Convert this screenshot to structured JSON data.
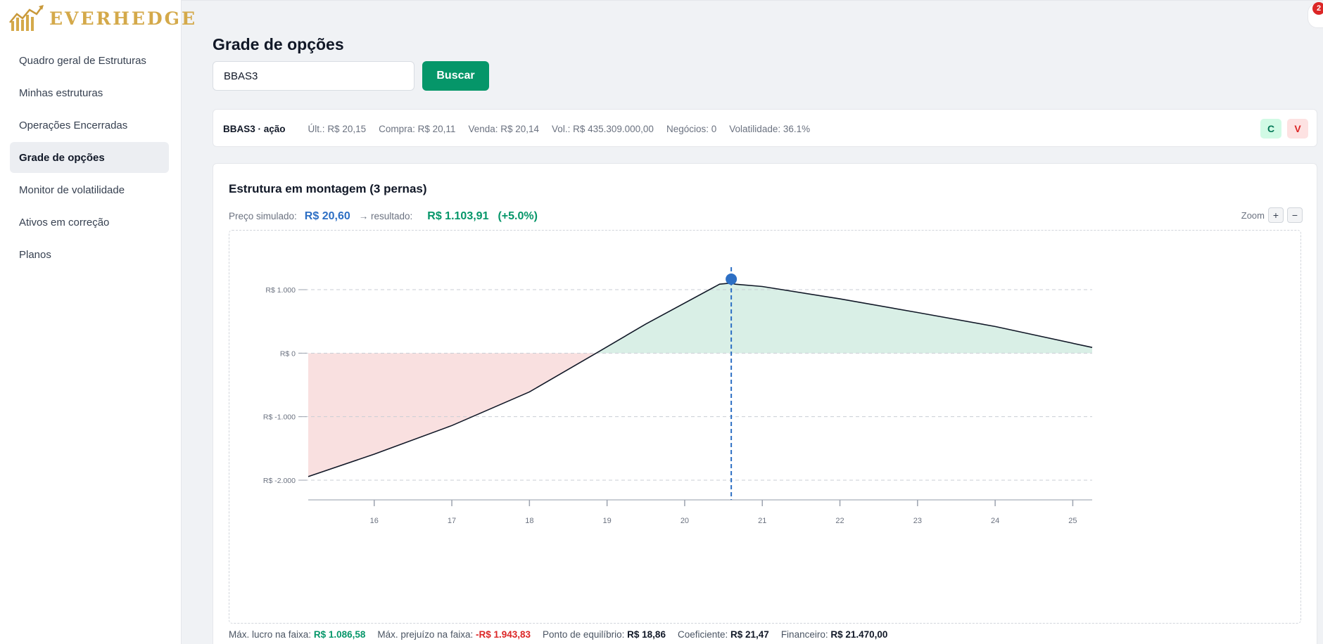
{
  "brand": {
    "name": "EVERHEDGE",
    "logo_icon": "chart-up-icon",
    "gold": "#d4a94a"
  },
  "sidebar": {
    "items": [
      {
        "label": "Quadro geral de Estruturas",
        "active": false
      },
      {
        "label": "Minhas estruturas",
        "active": false
      },
      {
        "label": "Operações Encerradas",
        "active": false
      },
      {
        "label": "Grade de opções",
        "active": true
      },
      {
        "label": "Monitor de volatilidade",
        "active": false
      },
      {
        "label": "Ativos em correção",
        "active": false
      },
      {
        "label": "Planos",
        "active": false
      }
    ]
  },
  "header": {
    "notification_count": "2"
  },
  "main": {
    "title": "Grade de opções",
    "search": {
      "value": "BBAS3",
      "button_label": "Buscar"
    },
    "quote": {
      "symbol": "BBAS3 · ação",
      "last_label": "Últ.:",
      "last": "R$ 20,15",
      "bid_label": "Compra:",
      "bid": "R$ 20,11",
      "ask_label": "Venda:",
      "ask": "R$ 20,14",
      "volume_label": "Vol.:",
      "volume": "R$ 435.309.000,00",
      "trades_label": "Negócios:",
      "trades": "0",
      "volatility_label": "Volatilidade:",
      "volatility": "36.1%",
      "buy_label": "C",
      "sell_label": "V"
    },
    "structure": {
      "title": "Estrutura em montagem (3 pernas)",
      "sim_label": "Preço simulado:",
      "sim_price": "R$ 20,60",
      "result_label": "→ resultado:",
      "result": "R$ 1.103,91",
      "result_pct": "(+5.0%)",
      "zoom_label": "Zoom",
      "zoom_in": "+",
      "zoom_out": "−"
    },
    "stats": {
      "max_profit_label": "Máx. lucro na faixa:",
      "max_profit": "R$ 1.086,58",
      "max_loss_label": "Máx. prejuízo na faixa:",
      "max_loss": "-R$ 1.943,83",
      "breakeven_label": "Ponto de equilíbrio:",
      "breakeven": "R$ 18,86",
      "coef_label": "Coeficiente:",
      "coef": "R$ 21,47",
      "fin_label": "Financeiro:",
      "fin": "R$ 21.470,00"
    }
  },
  "colors": {
    "accent": "#059669",
    "profit_fill": "#d9efe6",
    "loss_fill": "#f9e0e0",
    "marker": "#2d6fc4"
  },
  "chart_data": {
    "type": "line",
    "x": [
      15.15,
      16,
      17,
      18,
      18.86,
      19.5,
      20.45,
      20.6,
      20.65,
      21,
      22,
      23,
      24,
      25.25
    ],
    "values": [
      -1943.83,
      -1590,
      -1140,
      -610,
      0,
      460,
      1086.58,
      1103.91,
      1086.58,
      1050,
      855,
      640,
      420,
      90
    ],
    "xlim": [
      15.15,
      25.25
    ],
    "ylim": [
      -2000,
      1000
    ],
    "x_ticks": [
      16,
      17,
      18,
      19,
      20,
      21,
      22,
      23,
      24,
      25
    ],
    "y_ticks": [
      1000,
      0,
      -1000,
      -2000
    ],
    "y_tick_labels": [
      "R$ 1.000",
      "R$ 0",
      "R$ -1.000",
      "R$ -2.000"
    ],
    "marker_x": 20.6,
    "breakeven_x": 18.86,
    "grid": true,
    "positive_fill": "#d9efe6",
    "negative_fill": "#f9e0e0"
  }
}
